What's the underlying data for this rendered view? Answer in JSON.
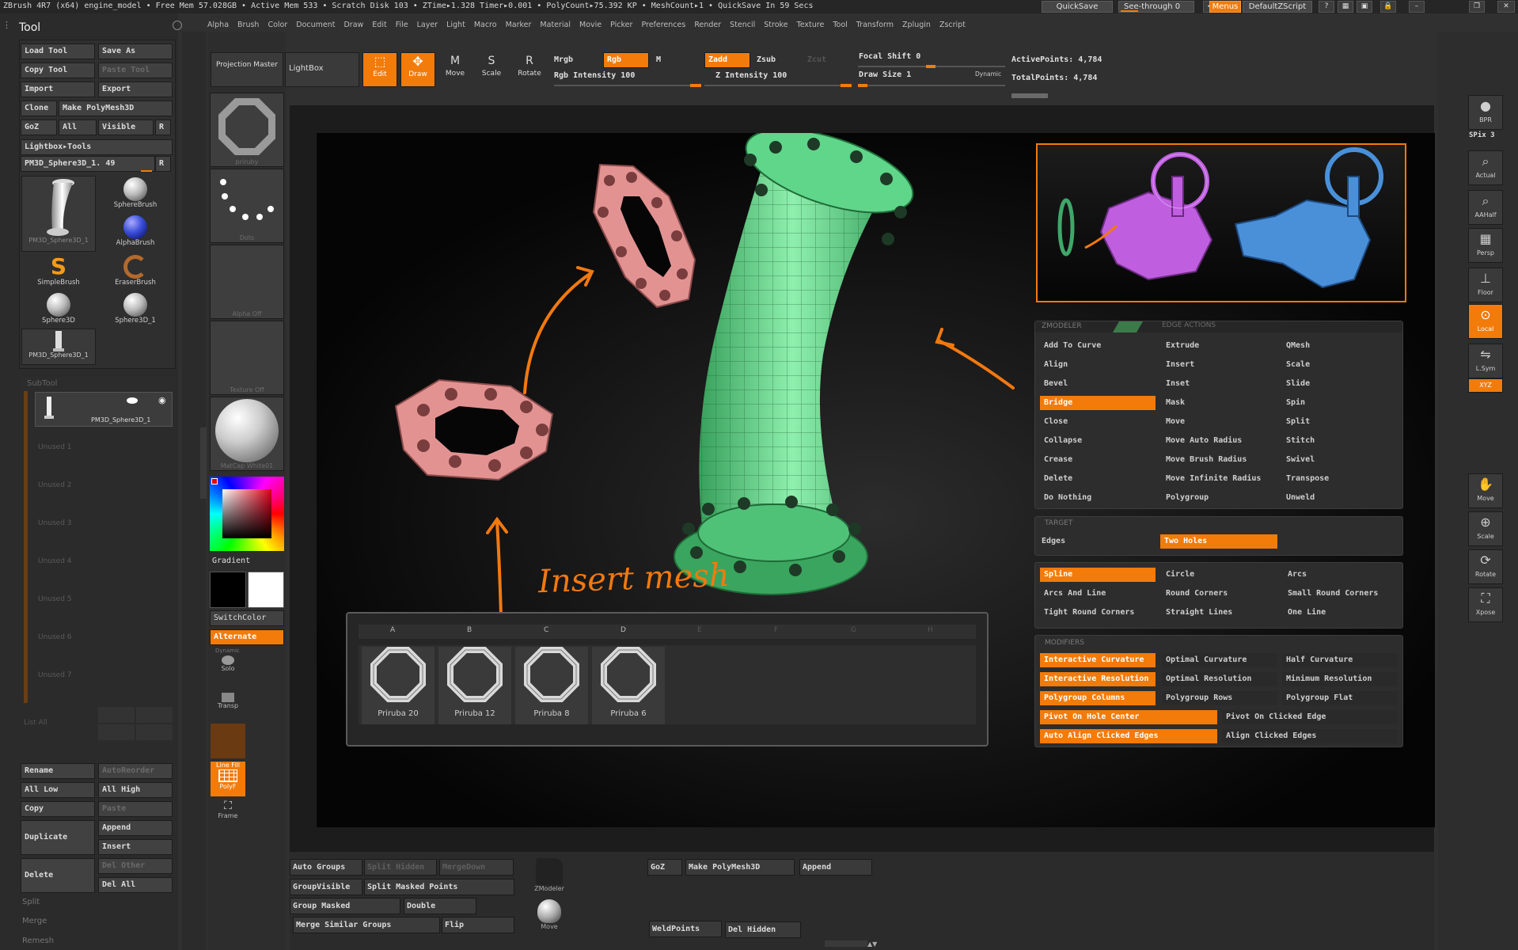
{
  "titlebar": {
    "status": "ZBrush 4R7 (x64)    engine_model    • Free Mem 57.028GB • Active Mem 533 • Scratch Disk 103 • ZTime▸1.328 Timer▸0.001 • PolyCount▸75.392 KP • MeshCount▸1 • QuickSave In 59 Secs",
    "quicksave": "QuickSave",
    "seethrough": "See-through  0",
    "menus": "Menus",
    "script": "DefaultZScript"
  },
  "menubar": [
    "Alpha",
    "Brush",
    "Color",
    "Document",
    "Draw",
    "Edit",
    "File",
    "Layer",
    "Light",
    "Macro",
    "Marker",
    "Material",
    "Movie",
    "Picker",
    "Preferences",
    "Render",
    "Stencil",
    "Stroke",
    "Texture",
    "Tool",
    "Transform",
    "Zplugin",
    "Zscript"
  ],
  "tool": {
    "title": "Tool",
    "buttons": [
      "Load Tool",
      "Save As",
      "Copy Tool",
      "Paste Tool",
      "Import",
      "Export",
      "Clone",
      "Make PolyMesh3D",
      "GoZ",
      "All",
      "Visible",
      "R"
    ],
    "lightbox": "Lightbox▸Tools",
    "current": "PM3D_Sphere3D_1. 49",
    "r": "R",
    "brushes": [
      {
        "name": "PM3D_Sphere3D_1",
        "icon": "pipe-icon"
      },
      {
        "name": "SphereBrush",
        "icon": "sphere-brush-icon"
      },
      {
        "name": "AlphaBrush",
        "icon": "alpha-brush-icon"
      },
      {
        "name": "SimpleBrush",
        "icon": "simple-brush-icon"
      },
      {
        "name": "EraserBrush",
        "icon": "eraser-brush-icon"
      },
      {
        "name": "Sphere3D",
        "icon": "sphere-icon"
      },
      {
        "name": "Sphere3D_1",
        "icon": "sphere-icon"
      },
      {
        "name": "PM3D_Sphere3D_1",
        "icon": "pipe-icon"
      }
    ]
  },
  "subtool": {
    "title": "SubTool",
    "active": "PM3D_Sphere3D_1",
    "slots": [
      "Unused 1",
      "Unused 2",
      "Unused 3",
      "Unused 4",
      "Unused 5",
      "Unused 6",
      "Unused 7"
    ],
    "list_all": "List All",
    "buttons": [
      "Rename",
      "AutoReorder",
      "All Low",
      "All High",
      "Copy",
      "Paste",
      "Duplicate",
      "Append",
      "Insert",
      "Delete",
      "Del Other",
      "Del All"
    ],
    "sections": [
      "Split",
      "Merge",
      "Remesh"
    ]
  },
  "shelf": {
    "projection": "Projection Master",
    "lightbox": "LightBox",
    "brush_label": "priruby",
    "stroke_label": "Dots",
    "alpha_label": "Alpha  Off",
    "texture_label": "Texture  Off",
    "material_label": "MatCap  White01",
    "gradient": "Gradient",
    "switch_color": "SwitchColor",
    "alternate": "Alternate",
    "dynamic": "Dynamic",
    "solo": "Solo",
    "transp": "Transp",
    "linefill": "Line Fill",
    "polyf": "PolyF",
    "frame": "Frame"
  },
  "toolbar": {
    "edit": "Edit",
    "draw": "Draw",
    "move": "Move",
    "scale": "Scale",
    "rotate": "Rotate",
    "mrgb": "Mrgb",
    "rgb": "Rgb",
    "m": "M",
    "zadd": "Zadd",
    "zsub": "Zsub",
    "zcut": "Zcut",
    "rgb_intensity": "Rgb  Intensity 100",
    "z_intensity": "Z  Intensity 100",
    "focal_shift": "Focal  Shift 0",
    "draw_size": "Draw  Size 1",
    "dynamic": "Dynamic",
    "active_points": "ActivePoints: 4,784",
    "total_points": "TotalPoints: 4,784"
  },
  "right_shelf": [
    {
      "label": "BPR",
      "icon": "bpr-icon"
    },
    {
      "label": "SPix 3",
      "icon": ""
    },
    {
      "label": "Actual",
      "icon": "actual-icon"
    },
    {
      "label": "AAHalf",
      "icon": "aahalf-icon"
    },
    {
      "label": "Persp",
      "icon": "persp-icon"
    },
    {
      "label": "Floor",
      "icon": "floor-icon"
    },
    {
      "label": "Local",
      "icon": "local-icon"
    },
    {
      "label": "L.Sym",
      "icon": "lsym-icon"
    },
    {
      "label": "XYZ",
      "icon": "xyz-icon"
    },
    {
      "label": "Move",
      "icon": "move-icon"
    },
    {
      "label": "Scale",
      "icon": "scale-icon"
    },
    {
      "label": "Rotate",
      "icon": "rotate-icon"
    },
    {
      "label": "Xpose",
      "icon": "xpose-icon"
    }
  ],
  "zmodeler": {
    "header": "ZMODELER",
    "header2": "EDGE ACTIONS",
    "col1": [
      "Add To Curve",
      "Align",
      "Bevel",
      "Bridge",
      "Close",
      "Collapse",
      "Crease",
      "Delete",
      "Do Nothing"
    ],
    "col2": [
      "Extrude",
      "Insert",
      "Inset",
      "Mask",
      "Move",
      "Move Auto Radius",
      "Move Brush Radius",
      "Move Infinite Radius",
      "Polygroup"
    ],
    "col3": [
      "QMesh",
      "Scale",
      "Slide",
      "Spin",
      "Split",
      "Stitch",
      "Swivel",
      "Transpose",
      "Unweld"
    ],
    "selected": "Bridge",
    "target_header": "TARGET",
    "target_label": "Edges",
    "target_value": "Two Holes",
    "spline": [
      "Spline",
      "Circle",
      "Arcs",
      "Arcs And Line",
      "Round Corners",
      "Small Round Corners",
      "Tight Round Corners",
      "Straight Lines",
      "One Line"
    ],
    "modifiers_header": "MODIFIERS",
    "modifiers": [
      "Interactive Curvature",
      "Optimal Curvature",
      "Half Curvature",
      "Interactive Resolution",
      "Optimal Resolution",
      "Minimum Resolution",
      "Polygroup Columns",
      "Polygroup Rows",
      "Polygroup Flat",
      "Pivot On Hole Center",
      "Pivot On Clicked Edge",
      "Auto Align Clicked Edges",
      "Align Clicked Edges"
    ]
  },
  "annotation": "Insert mesh",
  "insert_mesh": {
    "columns": [
      "A",
      "B",
      "C",
      "D",
      "E",
      "F",
      "G",
      "H"
    ],
    "items": [
      "Priruba 20",
      "Priruba 12",
      "Priruba 8",
      "Priruba 6"
    ]
  },
  "bottom": {
    "left": [
      "Auto Groups",
      "Split Hidden",
      "MergeDown",
      "GroupVisible",
      "Split Masked Points",
      "Group Masked",
      "Double",
      "Merge Similar Groups",
      "Flip"
    ],
    "zmodeler": "ZModeler",
    "move": "Move",
    "right": [
      "GoZ",
      "Make PolyMesh3D",
      "Append",
      "WeldPoints",
      "Del Hidden"
    ]
  },
  "colors": {
    "accent": "#f27b0a",
    "pipe": "#5fd68a",
    "flange": "#e08a8a",
    "purple": "#c05ee0",
    "blue": "#4a90d9"
  }
}
